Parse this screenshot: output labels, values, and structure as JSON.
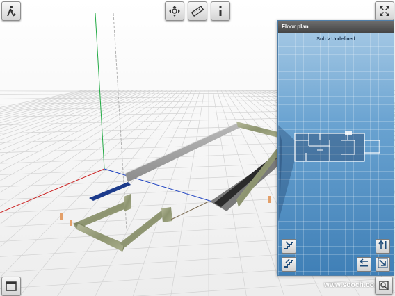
{
  "toolbar": {
    "walk_icon": "walking-person-icon",
    "navigate_icon": "four-way-arrows-icon",
    "measure_icon": "ruler-icon",
    "info_icon": "info-icon",
    "fullscreen_icon": "expand-arrows-icon"
  },
  "floor_plan": {
    "title": "Floor plan",
    "breadcrumb": "Sub > Undefined",
    "buttons": {
      "level_up_icon": "stairs-up-icon",
      "level_down_icon": "stairs-down-icon",
      "pan_up_icon": "arrow-up-bar-icon",
      "pan_left_icon": "arrow-left-bar-icon",
      "resize_icon": "resize-corner-icon"
    }
  },
  "bottom": {
    "panel_toggle_icon": "window-icon",
    "zoom_icon": "magnifier-icon"
  },
  "watermark": "www.sooch.co.uk",
  "colors": {
    "axis_x": "#cc2222",
    "axis_y": "#22aa44",
    "axis_z": "#1a3fc0",
    "panel_blue": "#5a97c8",
    "header_gray": "#555555",
    "wall_stone": "#9aa07a"
  }
}
